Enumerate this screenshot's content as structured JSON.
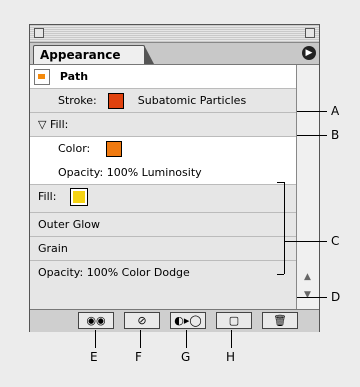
{
  "panel": {
    "tab_label": "Appearance",
    "header": "Path",
    "rows": [
      {
        "label": "Stroke:",
        "value": "Subatomic Particles",
        "swatch": "#e0420e"
      },
      {
        "label": "Fill:"
      },
      {
        "label": "Color:",
        "swatch": "#f07a10"
      },
      {
        "label": "Opacity: 100% Luminosity"
      },
      {
        "label": "Fill:",
        "swatch": "#f5d313"
      },
      {
        "label": "Outer Glow"
      },
      {
        "label": "Grain"
      },
      {
        "label": "Opacity: 100% Color Dodge"
      }
    ],
    "footer_icons": [
      "layers-icon",
      "clear-icon",
      "reduce-icon",
      "duplicate-icon",
      "trash-icon"
    ]
  },
  "callouts": [
    "A",
    "B",
    "C",
    "D",
    "E",
    "F",
    "G",
    "H"
  ],
  "colors": {
    "panel_bg": "#dadada",
    "list_bg": "#ffffff"
  }
}
